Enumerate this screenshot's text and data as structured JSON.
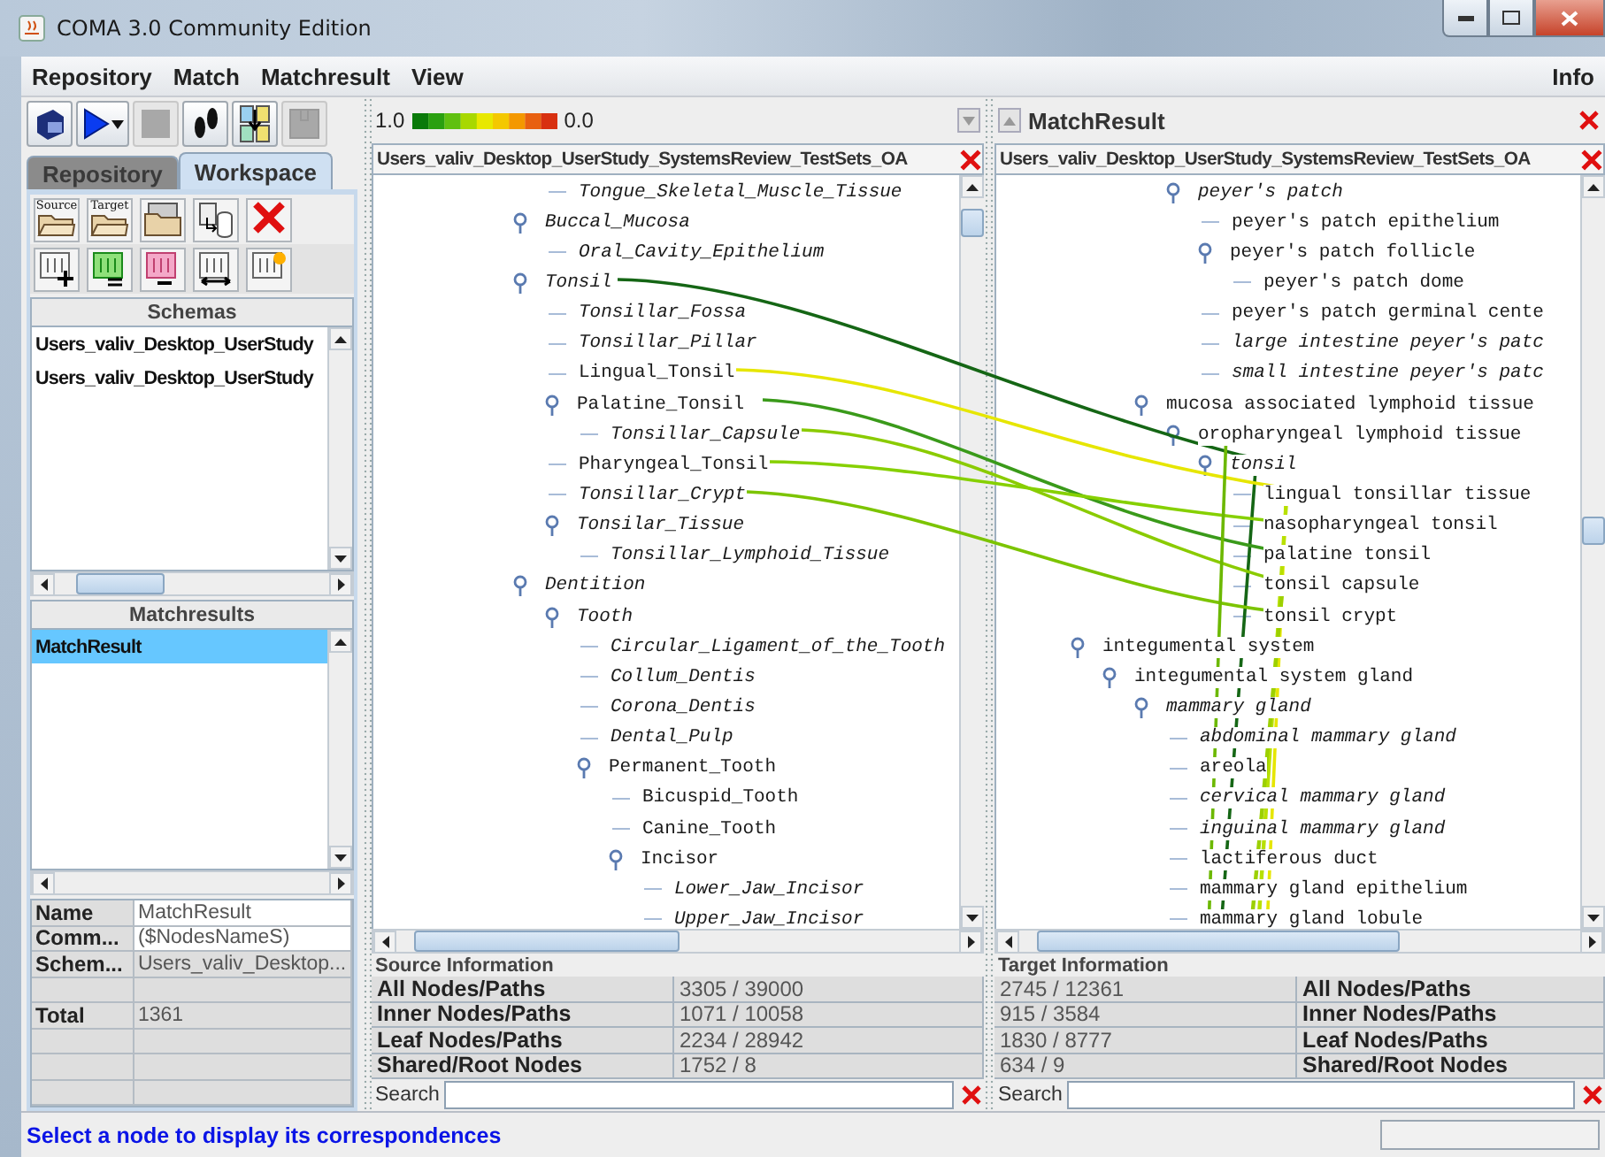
{
  "window": {
    "title": "COMA 3.0 Community Edition"
  },
  "menu": [
    {
      "label": "Repository"
    },
    {
      "label": "Match"
    },
    {
      "label": "Matchresult"
    },
    {
      "label": "View"
    }
  ],
  "menu_right": {
    "label": "Info"
  },
  "toolbar": [
    {
      "disabled": false
    },
    {
      "disabled": false
    },
    {
      "disabled": true
    },
    {
      "disabled": false
    },
    {
      "disabled": false
    },
    {
      "disabled": true
    }
  ],
  "left_tabs": [
    {
      "label": "Repository",
      "selected": false
    },
    {
      "label": "Workspace",
      "selected": true
    }
  ],
  "workspace_tools": {
    "source_label": "Source",
    "target_label": "Target"
  },
  "schemas": {
    "title": "Schemas",
    "items": [
      {
        "label": "Users_valiv_Desktop_UserStudy",
        "selected": false
      },
      {
        "label": "Users_valiv_Desktop_UserStudy",
        "selected": false
      }
    ]
  },
  "matchresults": {
    "title": "Matchresults",
    "items": [
      {
        "label": "MatchResult",
        "selected": true
      }
    ]
  },
  "properties": [
    {
      "kind": "field",
      "name": "Name",
      "value": "MatchResult",
      "editable": true
    },
    {
      "kind": "field",
      "name": "Comm...",
      "value": "($NodesNameS)",
      "editable": true
    },
    {
      "kind": "field",
      "name": "Schem...",
      "value": "Users_valiv_Desktop...",
      "editable": false
    },
    {
      "kind": "blank"
    },
    {
      "kind": "field",
      "name": "Total",
      "value": "1361",
      "editable": false
    },
    {
      "kind": "blank"
    },
    {
      "kind": "blank"
    },
    {
      "kind": "blank"
    }
  ],
  "source": {
    "scale": {
      "high": "1.0",
      "low": "0.0"
    },
    "schema_title": "Users_valiv_Desktop_UserStudy_SystemsReview_TestSets_OA",
    "tree": [
      {
        "children": [
          {
            "label": "Tongue_Skeletal_Muscle_Tissue",
            "italic": true
          }
        ]
      },
      {
        "label": "Buccal_Mucosa",
        "italic": true,
        "expanded": true,
        "children": [
          {
            "label": "Oral_Cavity_Epithelium",
            "italic": true
          }
        ]
      },
      {
        "label": "Tonsil",
        "italic": true,
        "expanded": true,
        "children": [
          {
            "label": "Tonsillar_Fossa",
            "italic": true
          },
          {
            "label": "Tonsillar_Pillar",
            "italic": true
          },
          {
            "label": "Lingual_Tonsil",
            "italic": false
          },
          {
            "label": "Palatine_Tonsil",
            "italic": false,
            "expanded": true,
            "children": [
              {
                "label": "Tonsillar_Capsule",
                "italic": true
              }
            ]
          },
          {
            "label": "Pharyngeal_Tonsil",
            "italic": false
          },
          {
            "label": "Tonsillar_Crypt",
            "italic": true
          },
          {
            "label": "Tonsilar_Tissue",
            "italic": true,
            "expanded": true,
            "children": [
              {
                "label": "Tonsillar_Lymphoid_Tissue",
                "italic": true
              }
            ]
          }
        ]
      },
      {
        "label": "Dentition",
        "italic": true,
        "expanded": true,
        "children": [
          {
            "label": "Tooth",
            "italic": true,
            "expanded": true,
            "children": [
              {
                "label": "Circular_Ligament_of_the_Tooth",
                "italic": true
              },
              {
                "label": "Collum_Dentis",
                "italic": true
              },
              {
                "label": "Corona_Dentis",
                "italic": true
              },
              {
                "label": "Dental_Pulp",
                "italic": true
              },
              {
                "label": "Permanent_Tooth",
                "italic": false,
                "expanded": true,
                "children": [
                  {
                    "label": "Bicuspid_Tooth",
                    "italic": false
                  },
                  {
                    "label": "Canine_Tooth",
                    "italic": false
                  },
                  {
                    "label": "Incisor",
                    "italic": false,
                    "expanded": true,
                    "children": [
                      {
                        "label": "Lower_Jaw_Incisor",
                        "italic": true
                      },
                      {
                        "label": "Upper_Jaw_Incisor",
                        "italic": true
                      }
                    ]
                  }
                ]
              }
            ]
          }
        ]
      }
    ],
    "info_title": "Source Information",
    "info": [
      {
        "label": "All Nodes/Paths",
        "value": "3305 / 39000"
      },
      {
        "label": "Inner Nodes/Paths",
        "value": "1071 / 10058"
      },
      {
        "label": "Leaf Nodes/Paths",
        "value": "2234 / 28942"
      },
      {
        "label": "Shared/Root Nodes",
        "value": "1752 / 8"
      }
    ],
    "search_label": "Search"
  },
  "target": {
    "title": "MatchResult",
    "schema_title": "Users_valiv_Desktop_UserStudy_SystemsReview_TestSets_OA",
    "tree": [
      {
        "children": [
          {
            "children": [
              {
                "children": [
                  {
                    "label": "peyer's patch",
                    "italic": true,
                    "expanded": true,
                    "children": [
                      {
                        "label": "peyer's patch epithelium",
                        "italic": false
                      },
                      {
                        "label": "peyer's patch follicle",
                        "italic": false,
                        "expanded": true,
                        "children": [
                          {
                            "label": "peyer's patch dome",
                            "italic": false
                          }
                        ]
                      },
                      {
                        "label": "peyer's patch germinal cente",
                        "italic": false
                      },
                      {
                        "label": "large intestine peyer's patc",
                        "italic": true
                      },
                      {
                        "label": "small intestine peyer's patc",
                        "italic": true
                      }
                    ]
                  }
                ]
              },
              {
                "label": "mucosa associated lymphoid tissue",
                "italic": false,
                "expanded": true,
                "children": [
                  {
                    "label": "oropharyngeal lymphoid tissue",
                    "italic": false,
                    "expanded": true,
                    "children": [
                      {
                        "label": "tonsil",
                        "italic": true,
                        "expanded": true,
                        "children": [
                          {
                            "label": "lingual tonsillar tissue",
                            "italic": false
                          },
                          {
                            "label": "nasopharyngeal tonsil",
                            "italic": false
                          },
                          {
                            "label": "palatine tonsil",
                            "italic": false
                          },
                          {
                            "label": "tonsil capsule",
                            "italic": false
                          },
                          {
                            "label": "tonsil crypt",
                            "italic": false
                          }
                        ]
                      }
                    ]
                  }
                ]
              }
            ]
          }
        ]
      },
      {
        "label": "integumental system",
        "italic": false,
        "expanded": true,
        "children": [
          {
            "label": "integumental system gland",
            "italic": false,
            "expanded": true,
            "children": [
              {
                "label": "mammary gland",
                "italic": true,
                "expanded": true,
                "children": [
                  {
                    "label": "abdominal mammary gland",
                    "italic": true
                  },
                  {
                    "label": "areola",
                    "italic": false
                  },
                  {
                    "label": "cervical mammary gland",
                    "italic": true
                  },
                  {
                    "label": "inguinal mammary gland",
                    "italic": true
                  },
                  {
                    "label": "lactiferous duct",
                    "italic": false
                  },
                  {
                    "label": "mammary gland epithelium",
                    "italic": false
                  },
                  {
                    "label": "mammary gland lobule",
                    "italic": false
                  }
                ]
              }
            ]
          }
        ]
      }
    ],
    "info_title": "Target Information",
    "info": [
      {
        "label": "All Nodes/Paths",
        "value": "2745 / 12361"
      },
      {
        "label": "Inner Nodes/Paths",
        "value": "915 / 3584"
      },
      {
        "label": "Leaf Nodes/Paths",
        "value": "1830 / 8777"
      },
      {
        "label": "Shared/Root Nodes",
        "value": "634 / 9"
      }
    ],
    "search_label": "Search"
  },
  "status": {
    "message": "Select a node to display its correspondences"
  }
}
